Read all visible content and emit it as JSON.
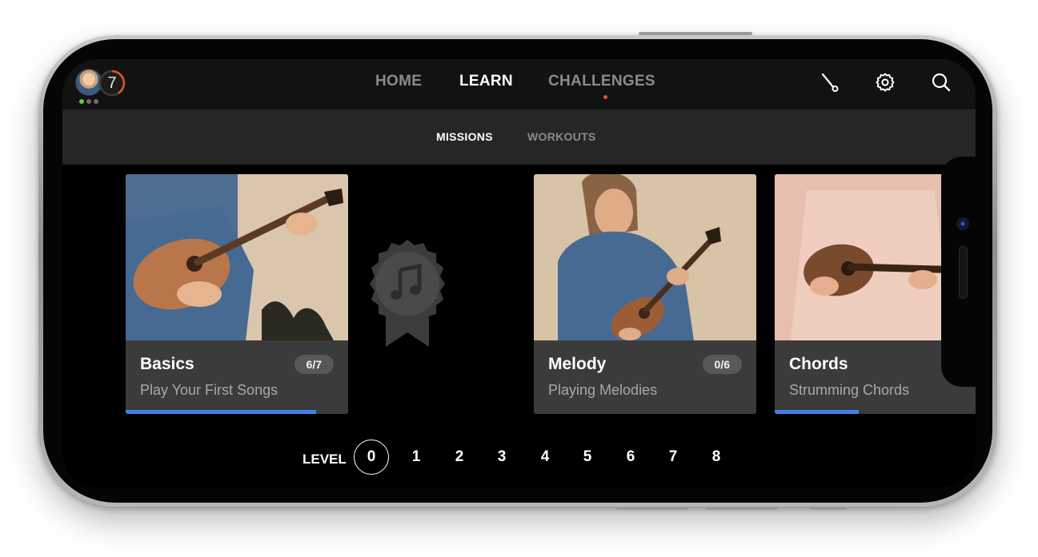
{
  "app": {
    "user_level": "7",
    "status_dots": [
      {
        "color": "#5fc94b"
      },
      {
        "color": "#6d6d6d"
      },
      {
        "color": "#6d6d6d"
      }
    ],
    "colors": {
      "accent_orange": "#e8542a",
      "progress_blue": "#3d82e8",
      "topbar": "#121212",
      "subbar": "#262626",
      "card": "#3b3b3b"
    }
  },
  "nav": {
    "items": [
      {
        "label": "HOME",
        "active": false
      },
      {
        "label": "LEARN",
        "active": true
      },
      {
        "label": "CHALLENGES",
        "active": false
      }
    ],
    "icons": [
      "tuner-icon",
      "gear-icon",
      "search-icon"
    ]
  },
  "subtabs": [
    {
      "label": "MISSIONS",
      "active": true
    },
    {
      "label": "WORKOUTS",
      "active": false
    }
  ],
  "cards": [
    {
      "title": "Basics",
      "badge": "6/7",
      "subtitle": "Play Your First Songs",
      "progress": 0.857
    },
    {
      "title": "Melody",
      "badge": "0/6",
      "subtitle": "Playing Melodies",
      "progress": 0
    },
    {
      "title": "Chords",
      "badge": "",
      "subtitle": "Strumming Chords",
      "progress": 0.376
    }
  ],
  "achievement_badge": {
    "icon": "music-note-icon"
  },
  "levels": {
    "label": "LEVEL",
    "items": [
      "0",
      "1",
      "2",
      "3",
      "4",
      "5",
      "6",
      "7",
      "8"
    ],
    "active_index": 0
  }
}
